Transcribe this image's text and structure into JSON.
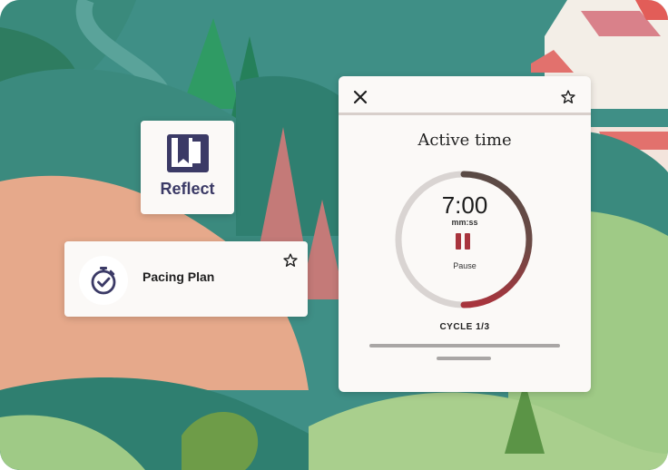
{
  "colors": {
    "bg_teal": "#3f8f86",
    "accent_red": "#a8343d",
    "ring_dark": "#5a4a45",
    "ring_track": "#d9d4d2",
    "card_bg": "#fbf9f7",
    "icon_ink": "#3b3a66"
  },
  "reflect": {
    "label": "Reflect",
    "icon": "bookmark-book-icon"
  },
  "pacing": {
    "title": "Pacing Plan",
    "icon": "stopwatch-check-icon",
    "star_icon": "star-outline-icon"
  },
  "timer": {
    "heading": "Active time",
    "time": "7:00",
    "unit": "mm:ss",
    "pause_label": "Pause",
    "cycle": "CYCLE 1/3",
    "progress_fraction": 0.5,
    "close_icon": "close-icon",
    "star_icon": "star-outline-icon"
  }
}
